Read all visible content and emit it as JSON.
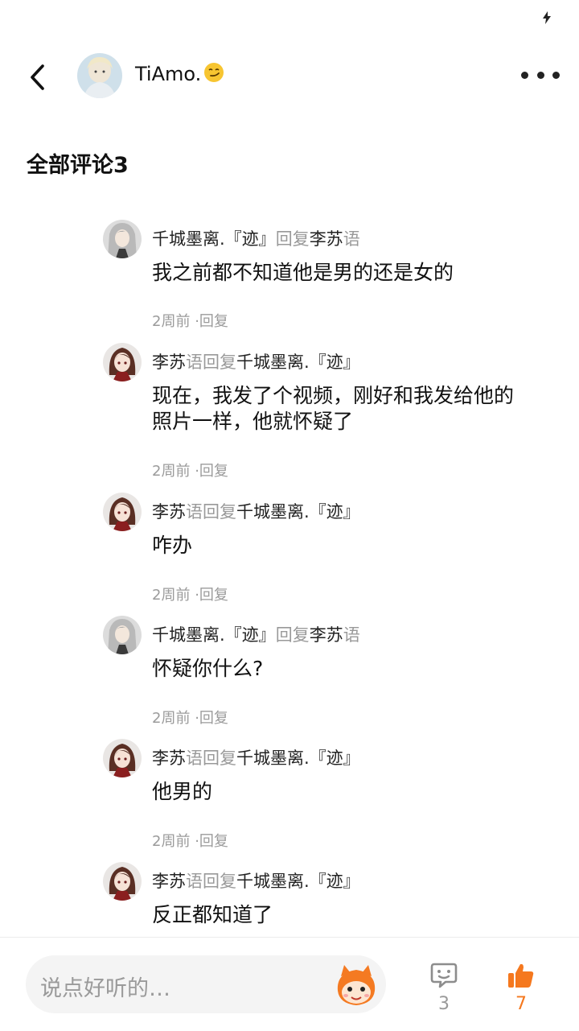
{
  "header": {
    "name": "TiAmo."
  },
  "section": {
    "title": "全部评论3"
  },
  "comments": [
    {
      "user": "千城墨离.『迹』",
      "reply_label": "回复",
      "target_main": "李苏",
      "target_tail": "语",
      "text": "我之前都不知道他是男的还是女的",
      "time": "2周前",
      "reply": "·回复",
      "avatar": "silver-hair-avatar"
    },
    {
      "user_main": "李苏",
      "user_tail": "语",
      "reply_label": "回复",
      "target": "千城墨离.『迹』",
      "text": "现在，我发了个视频，刚好和我发给他的照片一样，他就怀疑了",
      "time": "2周前",
      "reply": "·回复",
      "avatar": "brown-hair-avatar"
    },
    {
      "user_main": "李苏",
      "user_tail": "语",
      "reply_label": "回复",
      "target": "千城墨离.『迹』",
      "text": "咋办",
      "time": "2周前",
      "reply": "·回复",
      "avatar": "brown-hair-avatar"
    },
    {
      "user": "千城墨离.『迹』",
      "reply_label": "回复",
      "target_main": "李苏",
      "target_tail": "语",
      "text": "怀疑你什么?",
      "time": "2周前",
      "reply": "·回复",
      "avatar": "silver-hair-avatar"
    },
    {
      "user_main": "李苏",
      "user_tail": "语",
      "reply_label": "回复",
      "target": "千城墨离.『迹』",
      "text": "他男的",
      "time": "2周前",
      "reply": "·回复",
      "avatar": "brown-hair-avatar"
    },
    {
      "user_main": "李苏",
      "user_tail": "语",
      "reply_label": "回复",
      "target": "千城墨离.『迹』",
      "text": "反正都知道了",
      "avatar": "brown-hair-avatar"
    }
  ],
  "bottom": {
    "placeholder": "说点好听的…",
    "comment_count": "3",
    "like_count": "7",
    "like_color": "#f5781e",
    "comment_color": "#9a9a9a"
  }
}
